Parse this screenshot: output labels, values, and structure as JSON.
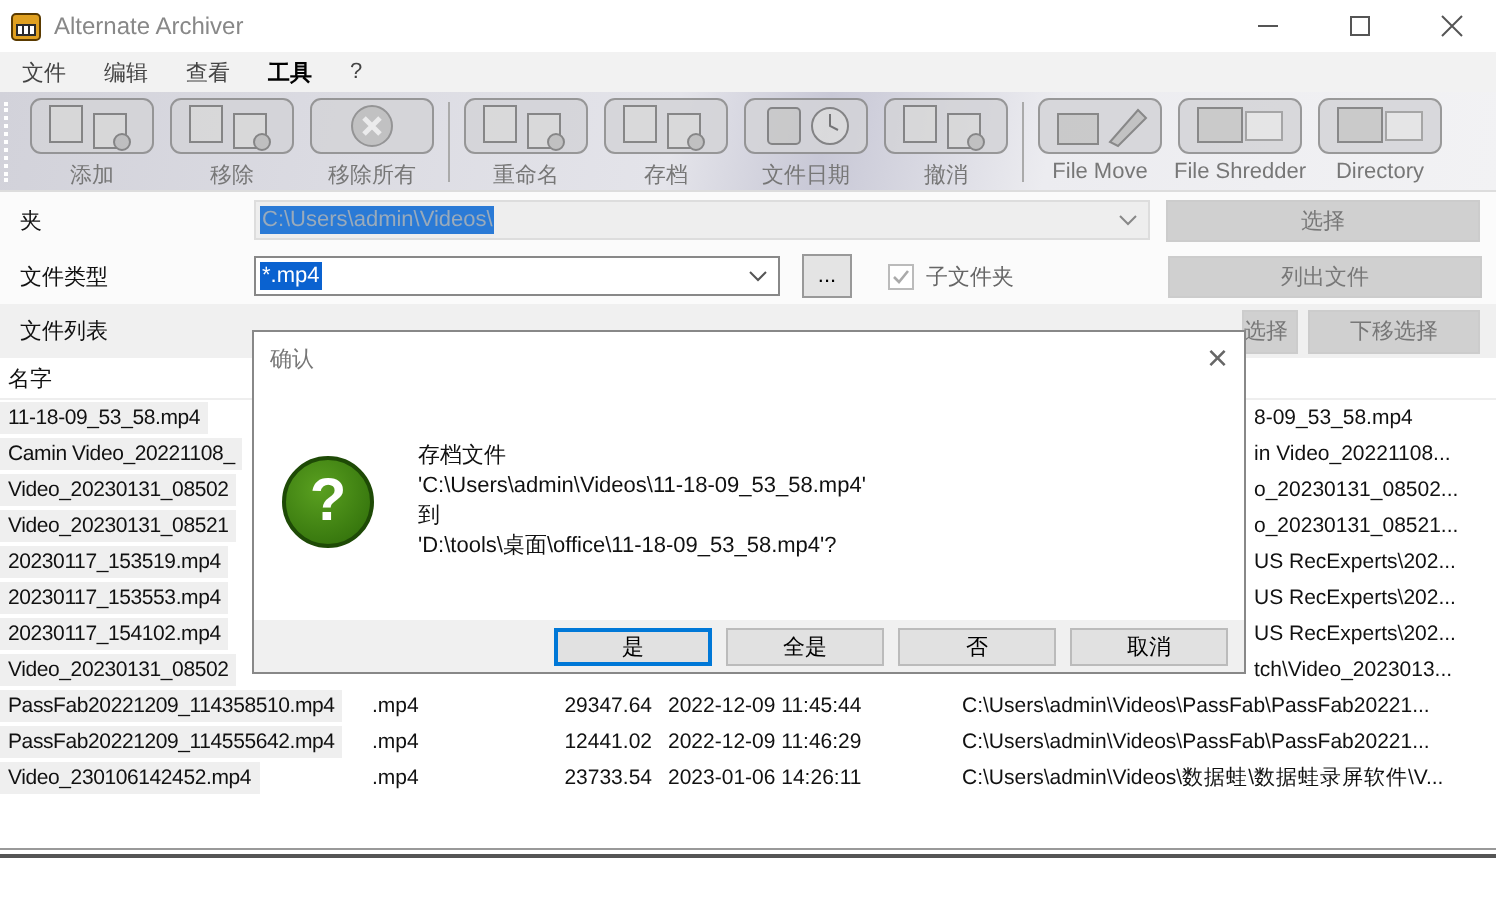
{
  "window": {
    "title": "Alternate Archiver"
  },
  "menu": [
    {
      "label": "文件",
      "selected": false
    },
    {
      "label": "编辑",
      "selected": false
    },
    {
      "label": "查看",
      "selected": false
    },
    {
      "label": "工具",
      "selected": true
    },
    {
      "label": "?",
      "selected": false
    }
  ],
  "toolbar": [
    [
      {
        "label": "添加",
        "disabled": true
      },
      {
        "label": "移除",
        "disabled": true
      },
      {
        "label": "移除所有",
        "disabled": true
      }
    ],
    [
      {
        "label": "重命名",
        "disabled": true
      },
      {
        "label": "存档",
        "disabled": true
      },
      {
        "label": "文件日期",
        "disabled": true
      },
      {
        "label": "撤消",
        "disabled": true
      }
    ],
    [
      {
        "label": "File Move",
        "disabled": true
      },
      {
        "label": "File Shredder",
        "disabled": true
      },
      {
        "label": "Directory",
        "disabled": true
      }
    ]
  ],
  "folder": {
    "label": "夹",
    "value": "C:\\Users\\admin\\Videos\\",
    "disabled": true
  },
  "file_type": {
    "label": "文件类型",
    "value": "*.mp4"
  },
  "browse_button": {
    "label": "..."
  },
  "subfolders": {
    "label": "子文件夹",
    "checked": true,
    "disabled": true
  },
  "side_buttons": [
    {
      "label": "选择",
      "disabled": true
    },
    {
      "label": "列出文件",
      "disabled": true
    }
  ],
  "list_label": "文件列表",
  "move_buttons": [
    {
      "label": "选择",
      "disabled": true
    },
    {
      "label": "下移选择",
      "disabled": true
    }
  ],
  "table": {
    "columns": [
      "名字"
    ],
    "rows": [
      {
        "name": "11-18-09_53_58.mp4",
        "path": "8-09_53_58.mp4",
        "selected": true
      },
      {
        "name": "Camin Video_20221108_",
        "path": "in Video_20221108...",
        "selected": true
      },
      {
        "name": "Video_20230131_08502",
        "path": "o_20230131_08502...",
        "selected": true
      },
      {
        "name": "Video_20230131_08521",
        "path": "o_20230131_08521...",
        "selected": true
      },
      {
        "name": "20230117_153519.mp4",
        "path": "US RecExperts\\202...",
        "selected": true
      },
      {
        "name": "20230117_153553.mp4",
        "path": "US RecExperts\\202...",
        "selected": true
      },
      {
        "name": "20230117_154102.mp4",
        "path": "US RecExperts\\202...",
        "selected": true
      },
      {
        "name": "Video_20230131_08502",
        "path": "tch\\Video_2023013...",
        "selected": true
      },
      {
        "name": "PassFab20221209_114358510.mp4",
        "ext": ".mp4",
        "size": "29347.64",
        "date": "2022-12-09 11:45:44",
        "path": "C:\\Users\\admin\\Videos\\PassFab\\PassFab20221...",
        "selected": true
      },
      {
        "name": "PassFab20221209_114555642.mp4",
        "ext": ".mp4",
        "size": "12441.02",
        "date": "2022-12-09 11:46:29",
        "path": "C:\\Users\\admin\\Videos\\PassFab\\PassFab20221...",
        "selected": true
      },
      {
        "name": "Video_230106142452.mp4",
        "ext": ".mp4",
        "size": "23733.54",
        "date": "2023-01-06 14:26:11",
        "path": "C:\\Users\\admin\\Videos\\数据蛙\\数据蛙录屏软件\\V...",
        "selected": true
      }
    ]
  },
  "dialog": {
    "title": "确认",
    "close": "×",
    "lines": [
      "存档文件",
      "'C:\\Users\\admin\\Videos\\11-18-09_53_58.mp4'",
      "到",
      "'D:\\tools\\桌面\\office\\11-18-09_53_58.mp4'?"
    ],
    "icon_glyph": "?",
    "buttons": [
      {
        "label": "是",
        "selected": true
      },
      {
        "label": "全是",
        "selected": false
      },
      {
        "label": "否",
        "selected": false
      },
      {
        "label": "取消",
        "selected": false
      }
    ]
  }
}
